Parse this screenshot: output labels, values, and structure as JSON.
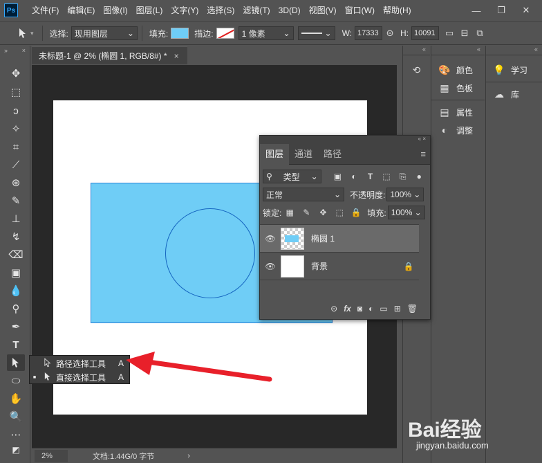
{
  "menubar": {
    "logo": "Ps",
    "items": [
      "文件(F)",
      "编辑(E)",
      "图像(I)",
      "图层(L)",
      "文字(Y)",
      "选择(S)",
      "滤镜(T)",
      "3D(D)",
      "视图(V)",
      "窗口(W)",
      "帮助(H)"
    ],
    "minimize": "—",
    "maximize": "❐",
    "close": "✕"
  },
  "options": {
    "select_label": "选择:",
    "select_value": "现用图层",
    "fill_label": "填充:",
    "stroke_label": "描边:",
    "stroke_width": "1 像素",
    "w_label": "W:",
    "w_value": "17333",
    "link_icon": "⊝",
    "h_label": "H:",
    "h_value": "10091",
    "fill_color": "#6fcdf6"
  },
  "document": {
    "tab_title": "未标题-1 @ 2% (椭圆 1, RGB/8#) *",
    "tab_close": "×",
    "zoom": "2%",
    "doc_info": "文档:1.44G/0 字节",
    "info_arrow": "›"
  },
  "panels": {
    "col1": [
      {
        "icon": "palette-icon",
        "glyph": "🎨",
        "label": "颜色"
      },
      {
        "icon": "swatches-icon",
        "glyph": "▦",
        "label": "色板"
      },
      {
        "icon": "properties-icon",
        "glyph": "▤",
        "label": "属性"
      },
      {
        "icon": "adjustments-icon",
        "glyph": "◐",
        "label": "调整"
      }
    ],
    "col2": [
      {
        "icon": "learn-icon",
        "glyph": "💡",
        "label": "学习"
      },
      {
        "icon": "libraries-icon",
        "glyph": "☁",
        "label": "库"
      }
    ]
  },
  "layers_panel": {
    "tabs": [
      "图层",
      "通道",
      "路径"
    ],
    "filter_label": "类型",
    "blend_mode": "正常",
    "opacity_label": "不透明度:",
    "opacity_value": "100%",
    "lock_label": "锁定:",
    "fill_label": "填充:",
    "fill_value": "100%",
    "layers": [
      {
        "name": "椭圆 1",
        "selected": true
      },
      {
        "name": "背景",
        "selected": false
      }
    ]
  },
  "flyout": {
    "items": [
      {
        "name": "路径选择工具",
        "key": "A",
        "active": false
      },
      {
        "name": "直接选择工具",
        "key": "A",
        "active": true
      }
    ]
  },
  "watermark": {
    "brand": "Bai经验",
    "url": "jingyan.baidu.com"
  }
}
